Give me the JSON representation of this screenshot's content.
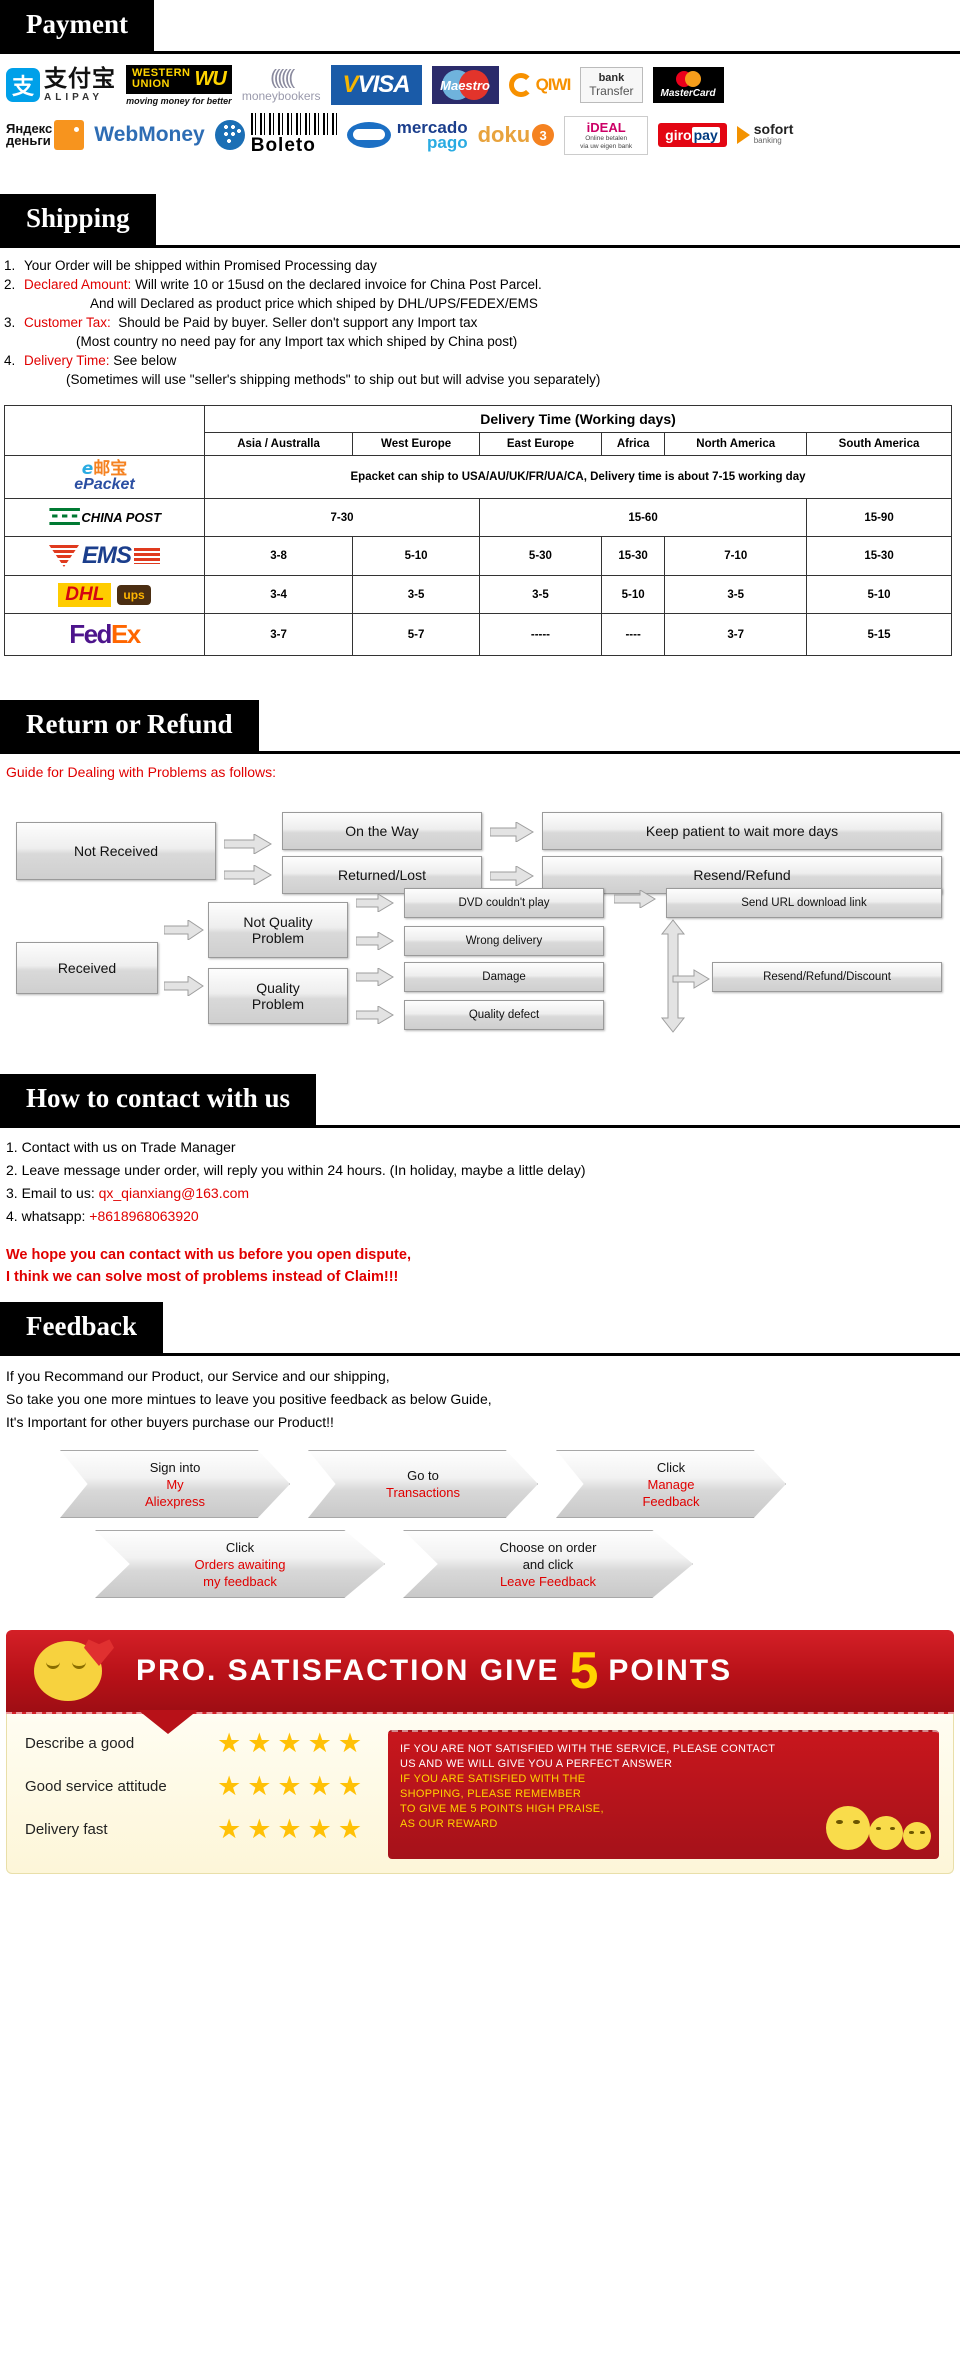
{
  "sections": {
    "payment": {
      "title": "Payment"
    },
    "shipping": {
      "title": "Shipping"
    },
    "return": {
      "title": "Return or Refund"
    },
    "contact": {
      "title": "How to contact with us"
    },
    "feedback": {
      "title": "Feedback"
    }
  },
  "payment_logos": {
    "alipay": {
      "mark": "支",
      "cn": "支付宝",
      "en": "ALIPAY"
    },
    "western_union": {
      "l1": "WESTERN",
      "l2": "UNION",
      "wu": "WU",
      "slogan": "moving money for better"
    },
    "moneybookers": {
      "waves": "((((((",
      "name": "moneybookers"
    },
    "visa": {
      "name": "VISA"
    },
    "maestro": {
      "name": "Maestro"
    },
    "qiwi": {
      "name": "QIWI"
    },
    "bank_transfer": {
      "l1": "bank",
      "l2": "Transfer"
    },
    "mastercard": {
      "name": "MasterCard"
    },
    "yandex": {
      "l1": "Яндекс",
      "l2": "деньги"
    },
    "webmoney": {
      "name": "WebMoney"
    },
    "boleto": {
      "name": "Boleto"
    },
    "mercadopago": {
      "l1": "mercado",
      "l2": "pago"
    },
    "doku": {
      "name": "doku",
      "ball": "3"
    },
    "ideal": {
      "l1": "iDEAL",
      "l2": "Online betalen",
      "l3": "via uw eigen bank"
    },
    "giropay": {
      "l1": "giro",
      "l2": "pay"
    },
    "sofort": {
      "l1": "sofort",
      "l2": "banking"
    }
  },
  "shipping_notes": [
    {
      "num": "1.",
      "label": "",
      "text": "Your Order will be shipped within Promised Processing day"
    },
    {
      "num": "2.",
      "label": "Declared Amount:",
      "text": "Will write 10 or 15usd on the declared invoice for China Post Parcel."
    },
    {
      "num": "",
      "label": "",
      "text": "And will Declared as product price which shiped by DHL/UPS/FEDEX/EMS",
      "indent": "ind"
    },
    {
      "num": "3.",
      "label": "Customer Tax:",
      "text": "Should be Paid by buyer. Seller don't support any Import tax"
    },
    {
      "num": "",
      "label": "",
      "text": "(Most country no need pay for any Import tax which shiped by China post)",
      "indent": "ind2"
    },
    {
      "num": "4.",
      "label": "Delivery Time:",
      "text": "See below"
    },
    {
      "num": "",
      "label": "",
      "text": "(Sometimes will use \"seller's shipping methods\" to ship out but will advise you separately)",
      "indent": "ind3"
    }
  ],
  "delivery_table": {
    "title": "Delivery Time (Working days)",
    "regions": [
      "Asia / Australla",
      "West Europe",
      "East Europe",
      "Africa",
      "North America",
      "South America"
    ],
    "epacket_note": "Epacket can ship to USA/AU/UK/FR/UA/CA, Delivery time is about 7-15 working day",
    "rows": [
      {
        "carrier": "ePacket",
        "span_note": true
      },
      {
        "carrier": "CHINA POST",
        "grouped": [
          {
            "text": "7-30",
            "span": 2
          },
          {
            "text": "15-60",
            "span": 3
          },
          {
            "text": "15-90",
            "span": 1
          }
        ]
      },
      {
        "carrier": "EMS",
        "values": [
          "3-8",
          "5-10",
          "5-30",
          "15-30",
          "7-10",
          "15-30"
        ]
      },
      {
        "carrier": "DHL UPS",
        "values": [
          "3-4",
          "3-5",
          "3-5",
          "5-10",
          "3-5",
          "5-10"
        ]
      },
      {
        "carrier": "FedEx",
        "values": [
          "3-7",
          "5-7",
          "-----",
          "----",
          "3-7",
          "5-15"
        ]
      }
    ]
  },
  "return_flow": {
    "guide_title": "Guide for Dealing with Problems as follows:",
    "not_received": "Not Received",
    "on_the_way": "On the Way",
    "returned_lost": "Returned/Lost",
    "keep_patient": "Keep patient to wait more days",
    "resend_refund": "Resend/Refund",
    "received": "Received",
    "not_quality_problem": "Not Quality\nProblem",
    "quality_problem": "Quality\nProblem",
    "dvd_couldnt_play": "DVD couldn't play",
    "wrong_delivery": "Wrong delivery",
    "damage": "Damage",
    "quality_defect": "Quality defect",
    "send_url": "Send URL download link",
    "resend_refund_discount": "Resend/Refund/Discount"
  },
  "contact": {
    "items": [
      {
        "num": "1.",
        "text": "Contact with us on Trade Manager",
        "em": ""
      },
      {
        "num": "2.",
        "text": "Leave message under order, will reply you within 24 hours. (In holiday, maybe a little delay)",
        "em": ""
      },
      {
        "num": "3.",
        "pre": "Email to us: ",
        "em": "qx_qianxiang@163.com"
      },
      {
        "num": "4.",
        "pre": "whatsapp: ",
        "em": "+8618968063920"
      }
    ],
    "note_line1": "We hope you can contact with us before you open dispute,",
    "note_line2": "I think we can solve most of problems instead of Claim!!!"
  },
  "feedback": {
    "intro_line1": "If you Recommand our Product, our Service and our shipping,",
    "intro_line2": "So take you one more mintues to leave you positive feedback as below Guide,",
    "intro_line3": "It's Important for other buyers purchase our Product!!",
    "steps": [
      {
        "top": "Sign into",
        "mid": "My",
        "bottom": "Aliexpress"
      },
      {
        "top": "Go to",
        "mid": "Transactions",
        "bottom": ""
      },
      {
        "top": "Click",
        "mid": "Manage",
        "bottom": "Feedback"
      },
      {
        "top": "Click",
        "mid": "Orders awaiting",
        "bottom": "my feedback"
      },
      {
        "top": "Choose on order",
        "mid": "and click",
        "bottom": "Leave Feedback"
      }
    ]
  },
  "banner": {
    "headline_left": "PRO. SATISFACTION  GIVE",
    "five": "5",
    "headline_right": "POINTS",
    "ratings": [
      {
        "label": "Describe a good",
        "stars": "★★★★★"
      },
      {
        "label": "Good service attitude",
        "stars": "★★★★★"
      },
      {
        "label": "Delivery fast",
        "stars": "★★★★★"
      }
    ],
    "red_lines": [
      {
        "text": "IF YOU ARE NOT SATISFIED WITH THE SERVICE, PLEASE CONTACT",
        "color": "white"
      },
      {
        "text": "US AND WE WILL GIVE YOU A PERFECT ANSWER",
        "color": "white"
      },
      {
        "text": "IF YOU ARE SATISFIED WITH THE",
        "color": "yellow"
      },
      {
        "text": "SHOPPING, PLEASE REMEMBER",
        "color": "yellow"
      },
      {
        "text": "TO GIVE ME 5 POINTS HIGH PRAISE,",
        "color": "yellow"
      },
      {
        "text": "AS OUR REWARD",
        "color": "yellow"
      }
    ]
  },
  "colors": {
    "accent_red": "#E00000",
    "header_black": "#000000",
    "banner_red": "#B81118",
    "star_gold": "#FFC107"
  }
}
